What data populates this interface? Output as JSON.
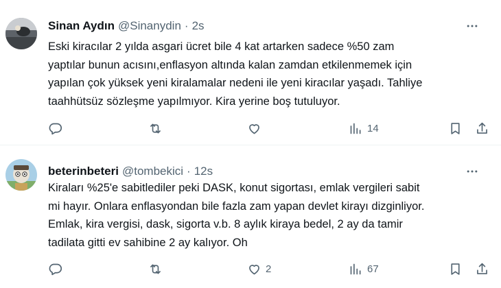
{
  "tweets": [
    {
      "name": "Sinan Aydın",
      "handle": "@Sinanydin",
      "separator": "·",
      "time": "2s",
      "text_lines": [
        "Eski kiracılar 2 yılda asgari ücret bile 4 kat artarken sadece %50 zam",
        "yaptılar bunun acısını,enflasyon altında kalan  zamdan etkilenmemek için",
        "yapılan çok yüksek yeni kiralamalar nedeni ile yeni kiracılar yaşadı. Tahliye",
        "taahhütsüz sözleşme yapılmıyor. Kira yerine boş tutuluyor."
      ],
      "reply_count": "",
      "retweet_count": "",
      "like_count": "",
      "views_count": "14",
      "avatar_icon": "profile-photo"
    },
    {
      "name": "beterinbeteri",
      "handle": "@tombekici",
      "separator": "·",
      "time": "12s",
      "text_lines": [
        "Kiraları %25'e sabitlediler peki DASK, konut sigortası, emlak vergileri sabit",
        "mi hayır. Onlara enflasyondan bile fazla zam yapan devlet kirayı dizginliyor.",
        "Emlak, kira vergisi, dask, sigorta v.b. 8 aylık kiraya bedel, 2 ay da tamir",
        "tadilata gitti ev sahibine 2 ay kalıyor. Oh"
      ],
      "reply_count": "",
      "retweet_count": "",
      "like_count": "2",
      "views_count": "67",
      "avatar_icon": "cartoon-avatar"
    }
  ],
  "colors": {
    "text": "#0f1419",
    "secondary": "#536471",
    "divider": "#eff3f4",
    "background": "#ffffff"
  }
}
